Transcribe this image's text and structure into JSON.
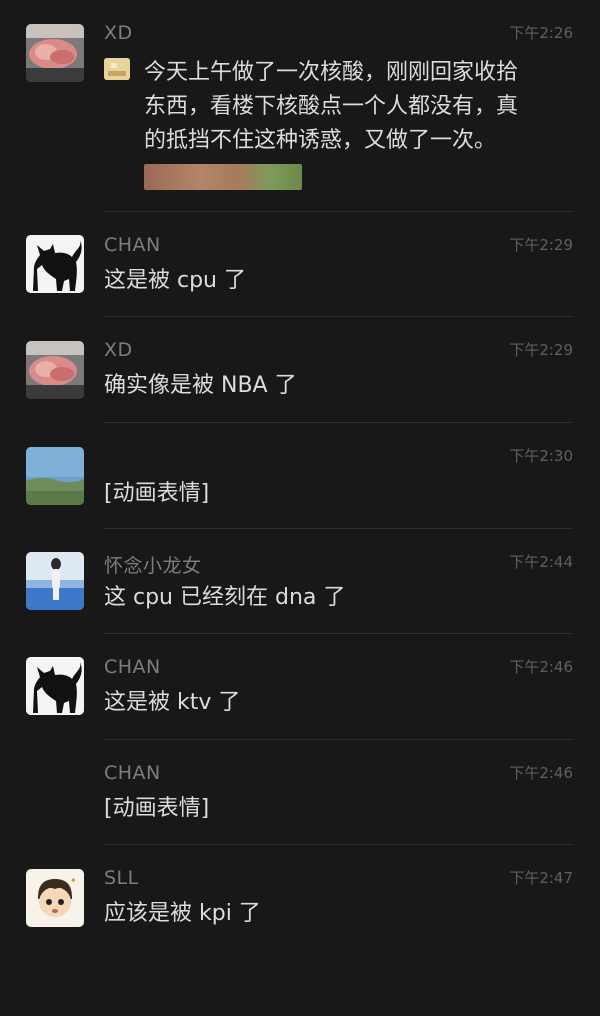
{
  "messages": [
    {
      "sender": "XD",
      "time": "下午2:26",
      "text": "今天上午做了一次核酸，刚刚回家收拾东西，看楼下核酸点一个人都没有，真的抵挡不住这种诱惑，又做了一次。",
      "avatar": "meat-photo"
    },
    {
      "sender": "CHAN",
      "time": "下午2:29",
      "text": "这是被 cpu 了",
      "avatar": "cat-silhouette"
    },
    {
      "sender": "XD",
      "time": "下午2:29",
      "text": "确实像是被 NBA 了",
      "avatar": "meat-photo"
    },
    {
      "sender": "",
      "time": "下午2:30",
      "text": "[动画表情]",
      "avatar": "landscape-photo"
    },
    {
      "sender": "怀念小龙女",
      "time": "下午2:44",
      "text": "这 cpu 已经刻在 dna 了",
      "avatar": "woman-beach-photo"
    },
    {
      "sender": "CHAN",
      "time": "下午2:46",
      "text": "这是被 ktv 了",
      "avatar": "cat-silhouette"
    },
    {
      "sender": "CHAN",
      "time": "下午2:46",
      "text": "[动画表情]",
      "avatar": ""
    },
    {
      "sender": "SLL",
      "time": "下午2:47",
      "text": "应该是被 kpi 了",
      "avatar": "cartoon-face"
    }
  ],
  "quote_lines": [
    "今天上午做了一次核酸，刚刚回家收拾",
    "东西，看楼下核酸点一个人都没有，真",
    "的抵挡不住这种诱惑，又做了一次。"
  ]
}
